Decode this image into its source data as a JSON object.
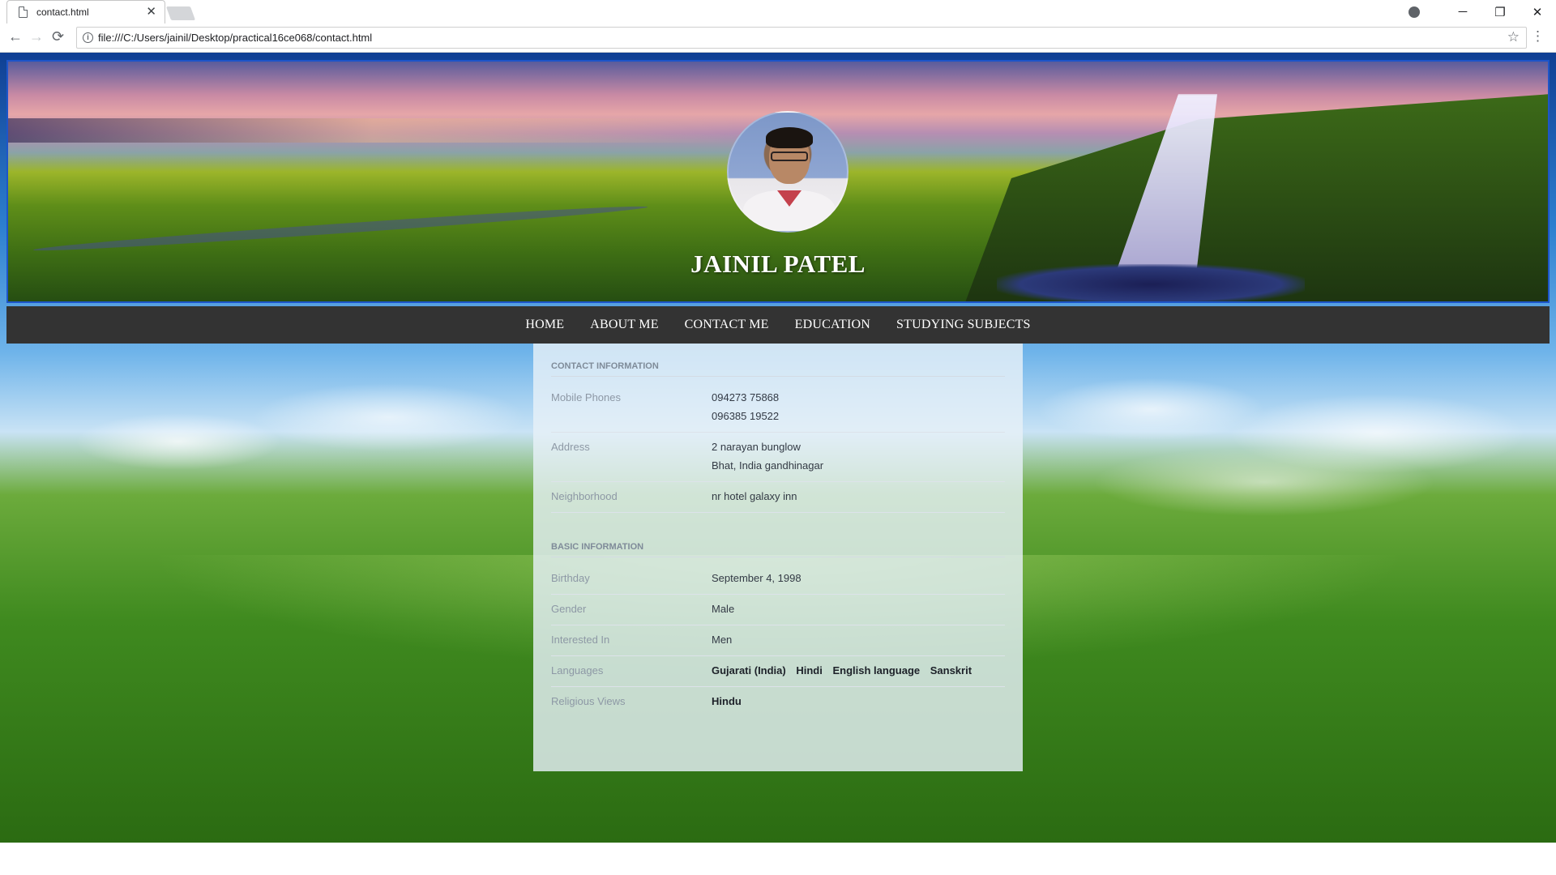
{
  "browser": {
    "tab_title": "contact.html",
    "tab_close": "✕",
    "url": "file:///C:/Users/jainil/Desktop/practical16ce068/contact.html",
    "back": "←",
    "forward": "→",
    "reload": "⟳",
    "info": "i",
    "star": "☆",
    "menu": "⋮",
    "minimize": "─",
    "restore": "❐",
    "close": "✕"
  },
  "header": {
    "name": "JAINIL PATEL"
  },
  "nav": {
    "items": [
      "HOME",
      "ABOUT ME",
      "CONTACT ME",
      "EDUCATION",
      "STUDYING SUBJECTS"
    ]
  },
  "contact": {
    "title": "CONTACT INFORMATION",
    "mobile_label": "Mobile Phones",
    "mobile_1": "094273 75868",
    "mobile_2": "096385 19522",
    "address_label": "Address",
    "address_1": "2 narayan bunglow",
    "address_2": "Bhat, India gandhinagar",
    "neighborhood_label": "Neighborhood",
    "neighborhood": "nr hotel galaxy inn"
  },
  "basic": {
    "title": "BASIC INFORMATION",
    "birthday_label": "Birthday",
    "birthday": "September 4, 1998",
    "gender_label": "Gender",
    "gender": "Male",
    "interested_label": "Interested In",
    "interested": "Men",
    "languages_label": "Languages",
    "languages": [
      "Gujarati (India)",
      "Hindi",
      "English language",
      "Sanskrit"
    ],
    "religious_label": "Religious Views",
    "religious": "Hindu"
  },
  "colors": {
    "nav_bg": "#333333",
    "banner_border": "#1d55c9",
    "card_bg": "#e6f0f8"
  }
}
